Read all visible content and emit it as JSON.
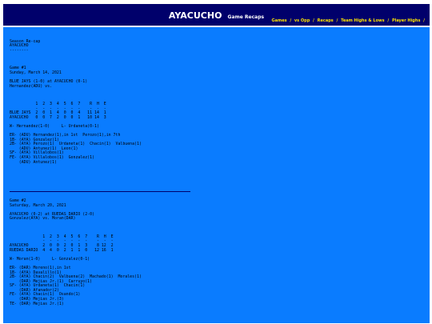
{
  "header": {
    "team": "AYACUCHO",
    "page": "Game Recaps",
    "nav": [
      "Games",
      "vs Opp",
      "Recaps",
      "Team Highs & Lows",
      "Player Highs"
    ],
    "nav_separator": "/"
  },
  "colors": {
    "header_bg": "#00006b",
    "nav_link": "#ffe400",
    "content_bg": "#0a7cff"
  },
  "recap": {
    "top": [
      "",
      "Season Re-cap",
      "AYACUCHO",
      "--------",
      "",
      "",
      "",
      "Game #1",
      "Sunday, March 14, 2021",
      "",
      "BLUE JAYS (1-0) at AYACUCHO (0-1)",
      "Hernandez(ADU) vs.",
      "",
      "",
      "",
      "           1  2  3  4  5  6  7    R  H  E",
      "           -  -  -  -  -  -  -    -  -  -",
      "BLUE JAYS  2  0  1  4  0  0  4   11 14  1",
      "AYACUCHO   0  0  7  2  0  0  1   10 14  3",
      "",
      "W- Hernandez(1-0)     L- Urdaneta(0-1)",
      "",
      "ER- (ADU) Hernandez(1),in 1st  Perozo(1),in 7th",
      "1B- (AYA) Gonzalez(1)",
      "2B- (AYA) Perozo(1)  Urdaneta(1)  Chacin(1)  Valbuena(1)",
      "    (ADU) Antunez(1)  Leon(1)",
      "SF- (AYA) Villalobos(1)",
      "FE- (AYA) Villalobos(1)  Gonzalez(1)",
      "    (ADU) Antunez(1)"
    ],
    "bottom": [
      "Game #2",
      "Saturday, March 20, 2021",
      "",
      "AYACUCHO (0-2) at RUEDAS DARIO (2-0)",
      "Gonzalez(AYA) vs. Moran(DAR)",
      "",
      "",
      "",
      "              1  2  3  4  5  6  7    R  H  E",
      "              -  -  -  -  -  -  -    -  -  -",
      "AYACUCHO      2  0  0  2  0  1  3    8 12  2",
      "RUEDAS DARIO  4  4  0  2  1  1  0   12 16  1",
      "",
      "W- Moran(1-0)     L- Gonzalez(0-1)",
      "",
      "ER- (DAR) Moreno(1),in 1st",
      "1B- (AYA) Davalillo(1)",
      "2B- (AYA) Chacin(2)  Valbuena(2)  Machado(1)  Morales(1)",
      "    (DAR) Mejias Jr.(1)  Carruyo(1)",
      "SF- (AYA) Urdaneta(1)  Chacin(1)",
      "    (DAR) Afanador(2)",
      "FE- (AYA) Chacin(1)  Osando(1)",
      "    (DAR) Mejias Jr.(3)",
      "TE- (DAR) Mejias Jr.(1)"
    ]
  }
}
